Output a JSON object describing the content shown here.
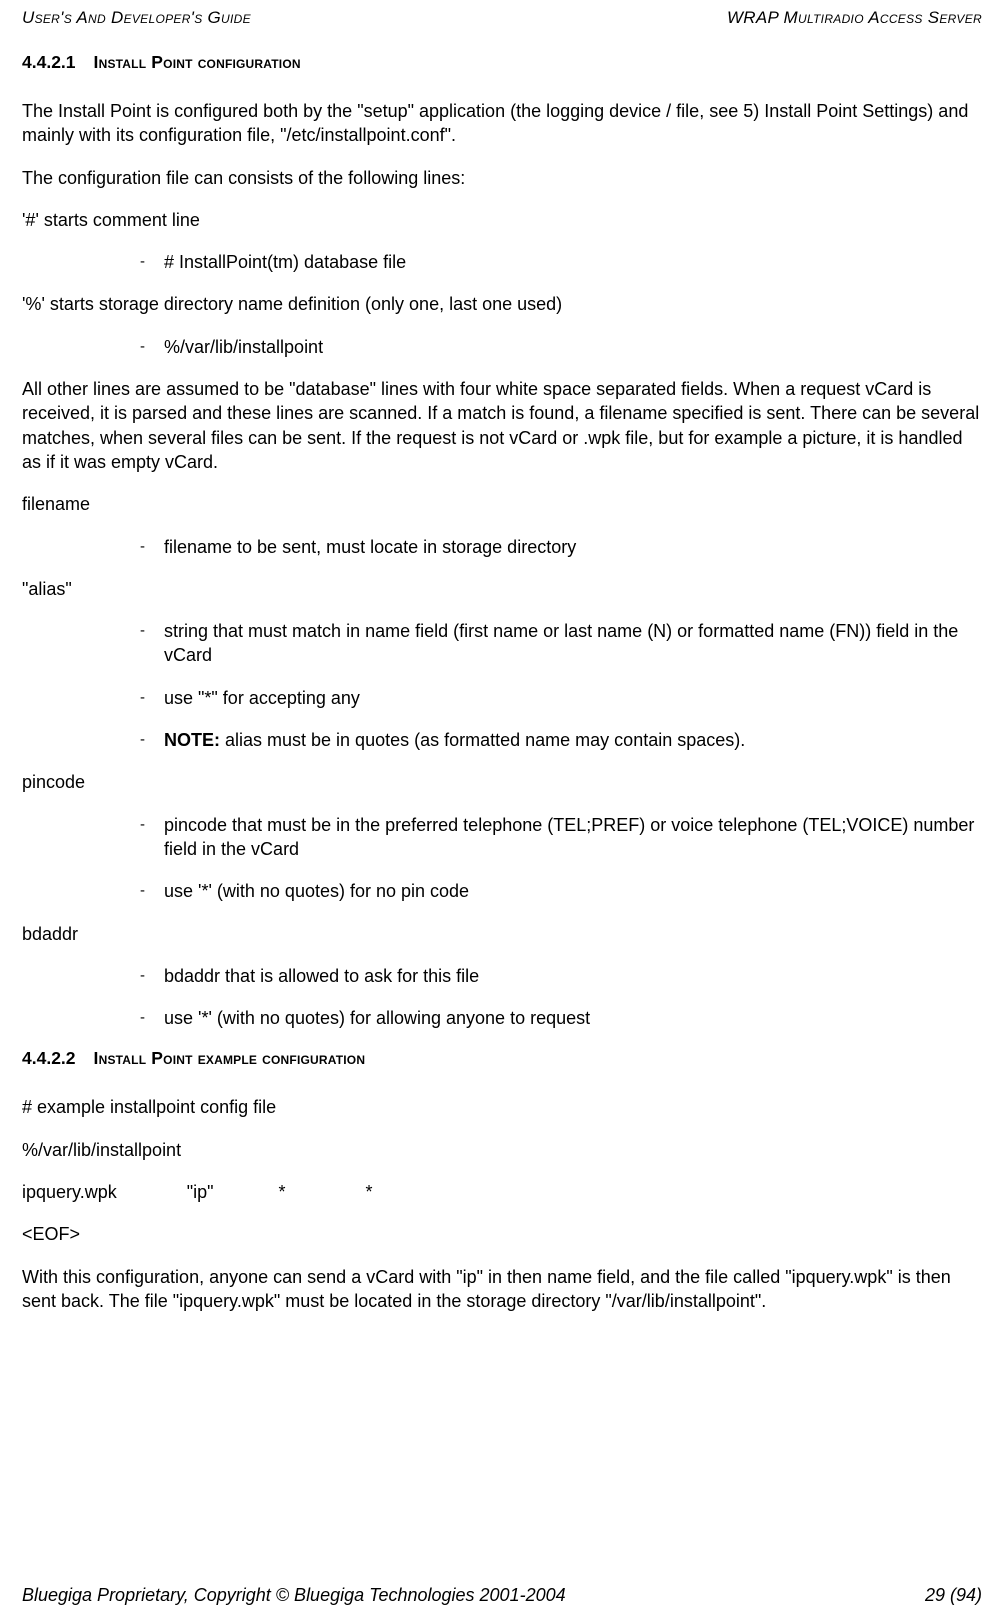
{
  "header": {
    "left": "User's And Developer's Guide",
    "right": "WRAP Multiradio Access Server"
  },
  "section1": {
    "num": "4.4.2.1",
    "title": "Install Point configuration"
  },
  "p1": "The Install Point is configured both by the \"setup\" application (the logging device / file, see 5) Install Point Settings) and mainly with its configuration file, \"/etc/installpoint.conf\".",
  "p2": "The configuration file can consists of the following lines:",
  "p3": "'#' starts comment line",
  "li1": "# InstallPoint(tm) database file",
  "p4": "'%' starts storage directory name definition (only one, last one used)",
  "li2": "%/var/lib/installpoint",
  "p5": "All other lines are assumed to be \"database\" lines with four white space separated fields. When a request vCard is received, it is parsed and these lines are scanned. If a match is found, a filename specified is sent. There can be several matches, when several files can be sent. If the request is not vCard or .wpk file, but for example a picture, it is handled as if it was empty vCard.",
  "p6": "filename",
  "li3": "filename to be sent, must locate in storage directory",
  "p7": "\"alias\"",
  "li4": "string that must match in name field (first name or last name (N) or formatted name (FN)) field in the vCard",
  "li5": "use \"*\" for accepting any",
  "li6a": "NOTE:",
  "li6b": " alias must be in quotes (as formatted name may contain spaces).",
  "p8": "pincode",
  "li7": "pincode that must be in the preferred telephone (TEL;PREF) or voice telephone (TEL;VOICE) number field in the vCard",
  "li8": "use '*' (with no quotes) for no pin code",
  "p9": "bdaddr",
  "li9": "bdaddr that is allowed to ask for this file",
  "li10": "use '*' (with no quotes) for allowing anyone to request",
  "section2": {
    "num": "4.4.2.2",
    "title": "Install Point example configuration"
  },
  "p10": "# example installpoint config file",
  "p11": "%/var/lib/installpoint",
  "p12": "ipquery.wpk              \"ip\"             *                *",
  "p13": "<EOF>",
  "p14": "With this configuration, anyone can send a vCard with \"ip\" in then name field, and the file called \"ipquery.wpk\" is then sent back. The file \"ipquery.wpk\" must be located in the storage directory \"/var/lib/installpoint\".",
  "footer": {
    "left": "Bluegiga Proprietary, Copyright © Bluegiga Technologies 2001-2004",
    "right": "29 (94)"
  }
}
